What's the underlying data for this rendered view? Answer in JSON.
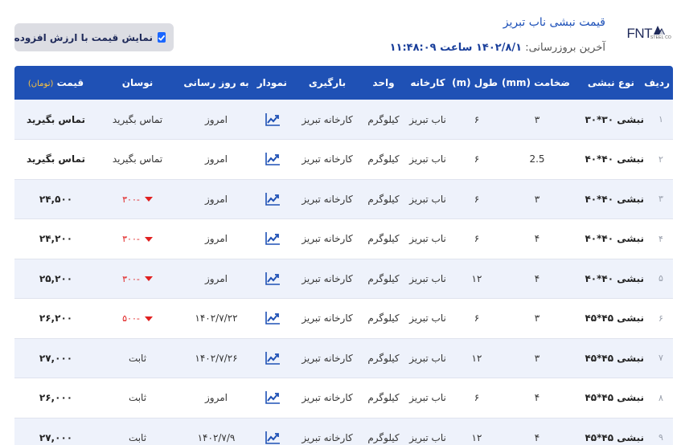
{
  "header": {
    "title": "قیمت نبشی ناب تبریز",
    "updated_label": "آخرین بروزرسانی:",
    "updated_value": "۱۴۰۲/۸/۱ ساعت ۱۱:۴۸:۰۹",
    "logo_text": "FNT",
    "logo_sub": "STEEL CO"
  },
  "toggle": {
    "label": "نمایش قیمت با ارزش افزوده",
    "checked": true
  },
  "table": {
    "columns": {
      "row": "ردیف",
      "type": "نوع نبشی",
      "thickness": "ضخامت (mm)",
      "length": "طول (m)",
      "factory": "کارخانه",
      "unit": "واحد",
      "loading": "بارگیری",
      "chart": "نمودار",
      "updated": "به روز رسانی",
      "change": "نوسان",
      "price": "قیمت",
      "price_unit": "(تومان)"
    },
    "rows": [
      {
        "idx": "۱",
        "type": "نبشی ۳۰*۳۰",
        "thickness": "۳",
        "length": "۶",
        "factory": "ناب تبریز",
        "unit": "کیلوگرم",
        "loading": "کارخانه تبریز",
        "updated": "امروز",
        "change": "تماس بگیرید",
        "change_dir": "none",
        "price": "تماس بگیرید"
      },
      {
        "idx": "۲",
        "type": "نبشی ۴۰*۴۰",
        "thickness": "2.5",
        "length": "۶",
        "factory": "ناب تبریز",
        "unit": "کیلوگرم",
        "loading": "کارخانه تبریز",
        "updated": "امروز",
        "change": "تماس بگیرید",
        "change_dir": "none",
        "price": "تماس بگیرید"
      },
      {
        "idx": "۳",
        "type": "نبشی ۴۰*۴۰",
        "thickness": "۳",
        "length": "۶",
        "factory": "ناب تبریز",
        "unit": "کیلوگرم",
        "loading": "کارخانه تبریز",
        "updated": "امروز",
        "change": "-۳۰۰",
        "change_dir": "down",
        "price": "۲۴,۵۰۰"
      },
      {
        "idx": "۴",
        "type": "نبشی ۴۰*۴۰",
        "thickness": "۴",
        "length": "۶",
        "factory": "ناب تبریز",
        "unit": "کیلوگرم",
        "loading": "کارخانه تبریز",
        "updated": "امروز",
        "change": "-۳۰۰",
        "change_dir": "down",
        "price": "۲۴,۲۰۰"
      },
      {
        "idx": "۵",
        "type": "نبشی ۴۰*۴۰",
        "thickness": "۴",
        "length": "۱۲",
        "factory": "ناب تبریز",
        "unit": "کیلوگرم",
        "loading": "کارخانه تبریز",
        "updated": "امروز",
        "change": "-۳۰۰",
        "change_dir": "down",
        "price": "۲۵,۲۰۰"
      },
      {
        "idx": "۶",
        "type": "نبشی ۴۵*۴۵",
        "thickness": "۳",
        "length": "۶",
        "factory": "ناب تبریز",
        "unit": "کیلوگرم",
        "loading": "کارخانه تبریز",
        "updated": "۱۴۰۲/۷/۲۲",
        "change": "-۵۰۰",
        "change_dir": "down",
        "price": "۲۶,۲۰۰"
      },
      {
        "idx": "۷",
        "type": "نبشی ۴۵*۴۵",
        "thickness": "۳",
        "length": "۱۲",
        "factory": "ناب تبریز",
        "unit": "کیلوگرم",
        "loading": "کارخانه تبریز",
        "updated": "۱۴۰۲/۷/۲۶",
        "change": "ثابت",
        "change_dir": "none",
        "price": "۲۷,۰۰۰"
      },
      {
        "idx": "۸",
        "type": "نبشی ۴۵*۴۵",
        "thickness": "۴",
        "length": "۶",
        "factory": "ناب تبریز",
        "unit": "کیلوگرم",
        "loading": "کارخانه تبریز",
        "updated": "امروز",
        "change": "ثابت",
        "change_dir": "none",
        "price": "۲۶,۰۰۰"
      },
      {
        "idx": "۹",
        "type": "نبشی ۴۵*۴۵",
        "thickness": "۴",
        "length": "۱۲",
        "factory": "ناب تبریز",
        "unit": "کیلوگرم",
        "loading": "کارخانه تبریز",
        "updated": "۱۴۰۲/۷/۹",
        "change": "ثابت",
        "change_dir": "none",
        "price": "۲۷,۰۰۰"
      }
    ]
  },
  "colors": {
    "header_bg": "#1f51b5",
    "accent_blue": "#1b4fb8",
    "price_unit": "#ffc53d",
    "down": "#e02020",
    "checkbox": "#1a66ff"
  },
  "icons": {
    "chart": "trending-up-icon",
    "checkbox": "check-icon",
    "change_down": "triangle-down-icon"
  }
}
